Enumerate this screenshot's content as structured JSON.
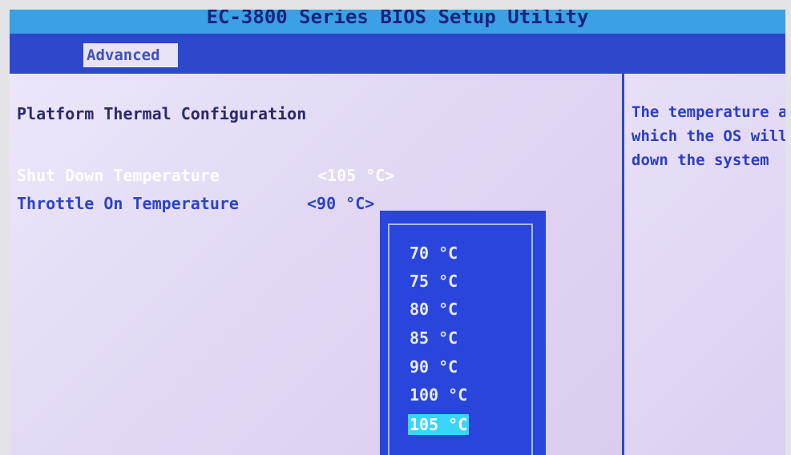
{
  "title": "EC-3800 Series BIOS Setup Utility",
  "tabs": [
    {
      "label": "Advanced"
    }
  ],
  "section_title": "Platform Thermal Configuration",
  "options": [
    {
      "label": "Shut Down Temperature",
      "value": "<105 °C>"
    },
    {
      "label": "Throttle On Temperature",
      "value": "<90 °C>"
    }
  ],
  "popup": {
    "items": [
      "70 °C",
      "75 °C",
      "80 °C",
      "85 °C",
      "90 °C",
      "100 °C",
      "105 °C"
    ],
    "selected": "105 °C"
  },
  "help_lines": [
    "The temperature at",
    "which the OS will shut",
    "down the system"
  ],
  "colors": {
    "menu_bar": "#2e48cc",
    "title_bar": "#3ba0e6",
    "panel_bg": "#e3d9f3",
    "highlight": "#38d6ff",
    "popup_bg": "#2a45dc"
  }
}
